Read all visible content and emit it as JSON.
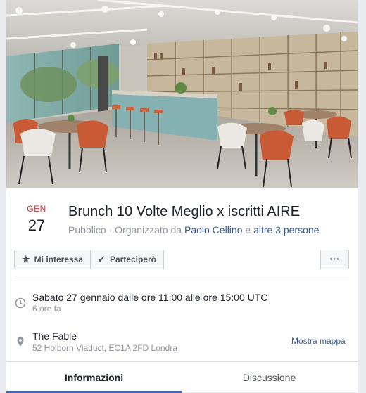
{
  "event": {
    "month": "GEN",
    "day": "27",
    "title": "Brunch 10 Volte Meglio x iscritti AIRE",
    "visibility": "Pubblico",
    "organized_by_prefix": "· Organizzato da",
    "organizer": "Paolo Cellino",
    "conjunction": "e",
    "others": "altre 3 persone"
  },
  "actions": {
    "interested_label": "Mi interessa",
    "interested_icon": "star-icon",
    "going_label": "Parteciperò",
    "going_icon": "check-icon",
    "more_label": "···"
  },
  "details": {
    "time_main": "Sabato 27 gennaio dalle ore 11:00 alle ore 15:00 UTC",
    "time_sub": "6 ore fa",
    "place_name": "The Fable",
    "place_address": "52 Holborn Viaduct, EC1A 2FD Londra",
    "map_link": "Mostra mappa"
  },
  "tabs": [
    {
      "label": "Informazioni",
      "active": true
    },
    {
      "label": "Discussione",
      "active": false
    }
  ],
  "colors": {
    "month_red": "#e02828",
    "link_blue": "#365899",
    "tab_underline": "#4267b2"
  }
}
